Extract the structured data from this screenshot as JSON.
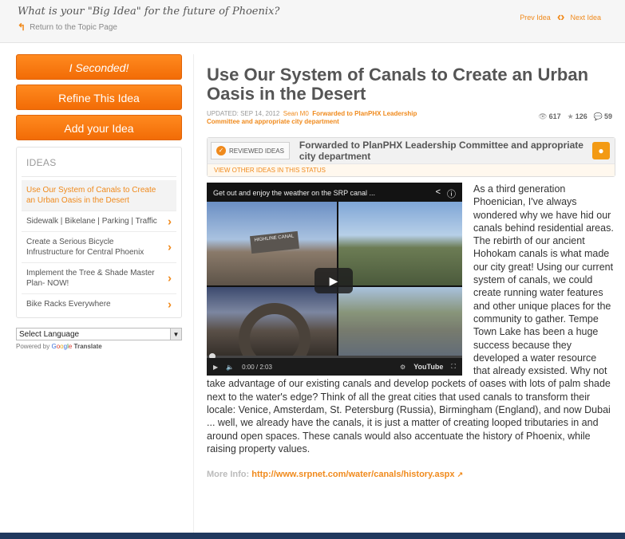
{
  "header": {
    "question": "What is your \"Big Idea\" for the future of Phoenix?",
    "return_label": "Return to the Topic Page",
    "prev_label": "Prev Idea",
    "next_label": "Next Idea"
  },
  "sidebar": {
    "buttons": {
      "seconded": "I Seconded!",
      "refine": "Refine This Idea",
      "add": "Add your Idea"
    },
    "ideas_title": "IDEAS",
    "ideas": [
      {
        "label": "Use Our System of Canals to Create an Urban Oasis in the Desert"
      },
      {
        "label": "Sidewalk | Bikelane | Parking | Traffic"
      },
      {
        "label": "Create a Serious Bicycle Infrustructure for Central Phoenix"
      },
      {
        "label": "Implement the Tree & Shade Master Plan- NOW!"
      },
      {
        "label": "Bike Racks Everywhere"
      }
    ],
    "language_select": "Select Language",
    "powered_by": "Powered by",
    "google": [
      "G",
      "o",
      "o",
      "g",
      "l",
      "e"
    ],
    "translate": "Translate"
  },
  "idea": {
    "title": "Use Our System of Canals to Create an Urban Oasis in the Desert",
    "updated": "UPDATED: SEP 14, 2012",
    "author": "Sean M0",
    "forwarded_line1": "Forwarded to PlanPHX Leadership",
    "forwarded_line2": "Committee and appropriate city department",
    "stats": {
      "views": "617",
      "stars": "126",
      "comments": "59"
    },
    "status_badge": "REVIEWED IDEAS",
    "status_text": "Forwarded to PlanPHX Leadership Committee and appropriate city department",
    "view_other": "VIEW OTHER IDEAS IN THIS STATUS",
    "video": {
      "title": "Get out and enjoy the weather on the SRP canal ...",
      "time": "0:00 / 2:03",
      "sign_text": "HIGHLINE CANAL",
      "logo": "YouTube"
    },
    "body": "As a third generation Phoenician, I've always wondered why we have hid our canals behind residential areas. The rebirth of our ancient Hohokam canals is what made our city great! Using our current system of canals, we could create running water features and other unique places for the community to gather. Tempe Town Lake has been a huge success because they developed a water resource that already exsisted. Why not take advantage of our existing canals and develop pockets of oases with lots of palm shade next to the water's edge? Think of all the great cities that used canals to transform their locale: Venice, Amsterdam, St. Petersburg (Russia), Birmingham (England), and now Dubai ... well, we already have the canals, it is just a matter of creating looped tributaries in and around open spaces. These canals would also accentuate the history of Phoenix, while raising property values.",
    "more_info_label": "More Info:",
    "more_info_link": "http://www.srpnet.com/water/canals/history.aspx"
  }
}
